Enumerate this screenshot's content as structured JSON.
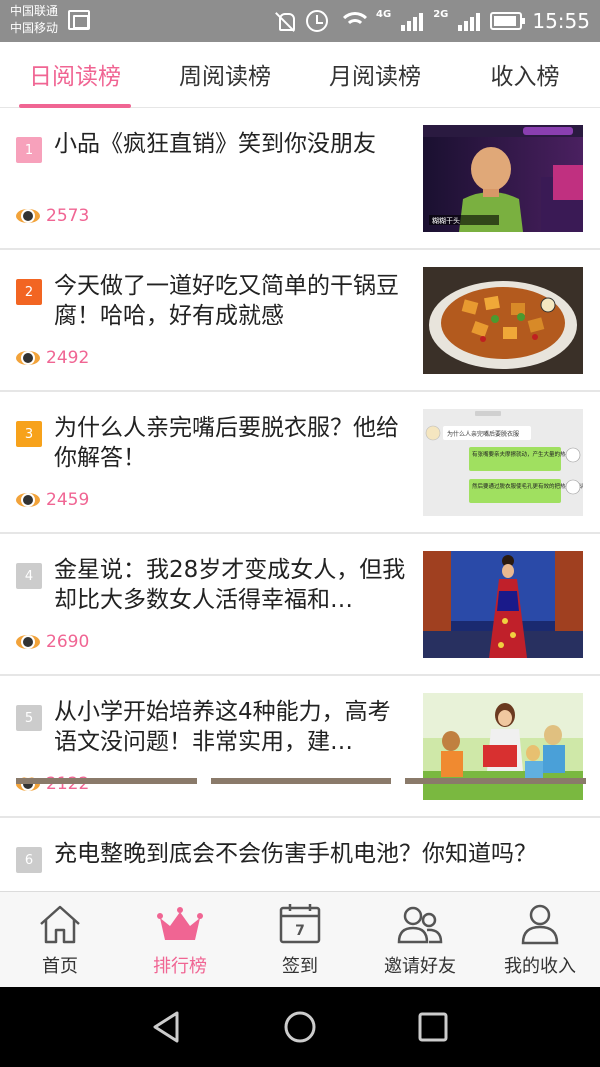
{
  "status_bar": {
    "carrier_1": "中国联通",
    "carrier_2": "中国移动",
    "net_4g": "4G",
    "net_2g": "2G",
    "time": "15:55"
  },
  "tabs": [
    {
      "label": "日阅读榜",
      "active": true
    },
    {
      "label": "周阅读榜",
      "active": false
    },
    {
      "label": "月阅读榜",
      "active": false
    },
    {
      "label": "收入榜",
      "active": false
    }
  ],
  "articles": [
    {
      "rank": "1",
      "rank_color": "#f7a1bb",
      "title": "小品《疯狂直销》笑到你没朋友",
      "views": "2573",
      "thumb_icon": "comedy-stage-photo"
    },
    {
      "rank": "2",
      "rank_color": "#f26522",
      "title": "今天做了一道好吃又简单的干锅豆腐！哈哈，好有成就感",
      "views": "2492",
      "thumb_icon": "tofu-dish-photo"
    },
    {
      "rank": "3",
      "rank_color": "#f7a21b",
      "title": "为什么人亲完嘴后要脱衣服？他给你解答！",
      "views": "2459",
      "thumb_icon": "chat-screenshot"
    },
    {
      "rank": "4",
      "rank_color": "#cccccc",
      "title": "金星说：我28岁才变成女人，但我却比大多数女人活得幸福和…",
      "views": "2690",
      "thumb_icon": "stage-dress-photo"
    },
    {
      "rank": "5",
      "rank_color": "#cccccc",
      "title": "从小学开始培养这4种能力，高考语文没问题！非常实用，建…",
      "views": "2122",
      "thumb_icon": "kids-reading-photo"
    },
    {
      "rank": "6",
      "rank_color": "#cccccc",
      "title": "充电整晚到底会不会伤害手机电池？你知道吗？"
    }
  ],
  "thumb_text": {
    "article_1_caption": "糊糊干头",
    "article_3_question": "为什么人亲完嘴后要脱衣服",
    "article_3_reply_1": "有张嘴要亲夫摩擦就动，产生大量的热",
    "article_3_reply_2": "然后要通过脱衣服使毛孔更有效的把热量排出啊"
  },
  "bottom_nav": [
    {
      "label": "首页",
      "icon": "home-icon",
      "active": false
    },
    {
      "label": "排行榜",
      "icon": "crown-icon",
      "active": true
    },
    {
      "label": "签到",
      "icon": "calendar-icon",
      "active": false,
      "badge": "7"
    },
    {
      "label": "邀请好友",
      "icon": "invite-friends-icon",
      "active": false
    },
    {
      "label": "我的收入",
      "icon": "profile-icon",
      "active": false
    }
  ],
  "colors": {
    "accent": "#f06593",
    "status_bar": "#8e8e8e",
    "view_icon": "#f2a33a"
  }
}
